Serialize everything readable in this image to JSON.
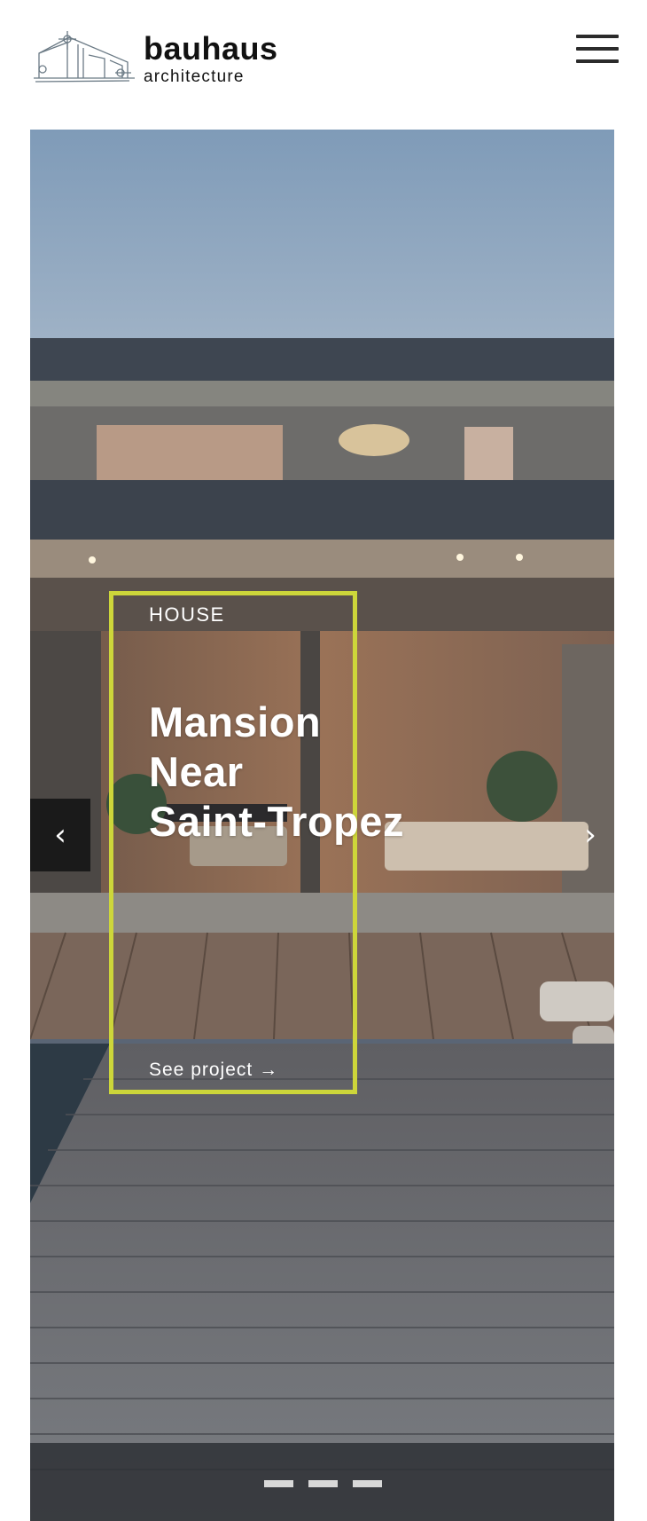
{
  "header": {
    "brand_name": "bauhaus",
    "brand_sub": "architecture",
    "menu_icon": "hamburger-menu-icon"
  },
  "slider": {
    "category": "HOUSE",
    "title_lines": [
      "Mansion",
      "Near",
      "Saint-Tropez"
    ],
    "cta_label": "See project →",
    "prev_label": "‹",
    "next_label": "›",
    "slide_count": 3,
    "accent_color": "#cdd63a"
  }
}
